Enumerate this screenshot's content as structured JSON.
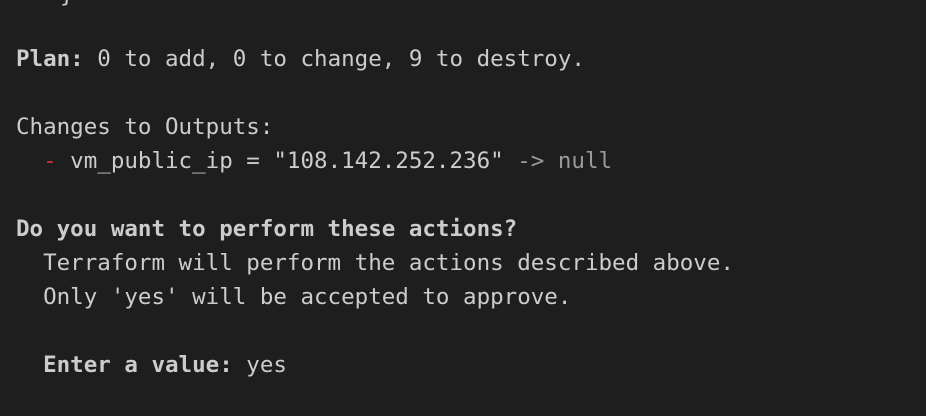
{
  "terminal": {
    "top_partial_glyph": "}",
    "plan": {
      "label": "Plan:",
      "text": " 0 to add, 0 to change, 9 to destroy."
    },
    "outputs_header": "Changes to Outputs:",
    "output_line": {
      "indent": "  ",
      "marker": "-",
      "assignment": " vm_public_ip = \"108.142.252.236\"",
      "arrow_null": " -> null"
    },
    "question": "Do you want to perform these actions?",
    "info_line_1": "  Terraform will perform the actions described above.",
    "info_line_2": "  Only 'yes' will be accepted to approve.",
    "prompt": {
      "label": "  Enter a value:",
      "value": " yes"
    }
  },
  "colors": {
    "background": "#1e1e1e",
    "text": "#cccccc",
    "minus": "#cd3131",
    "dim": "#9a9a9a"
  }
}
